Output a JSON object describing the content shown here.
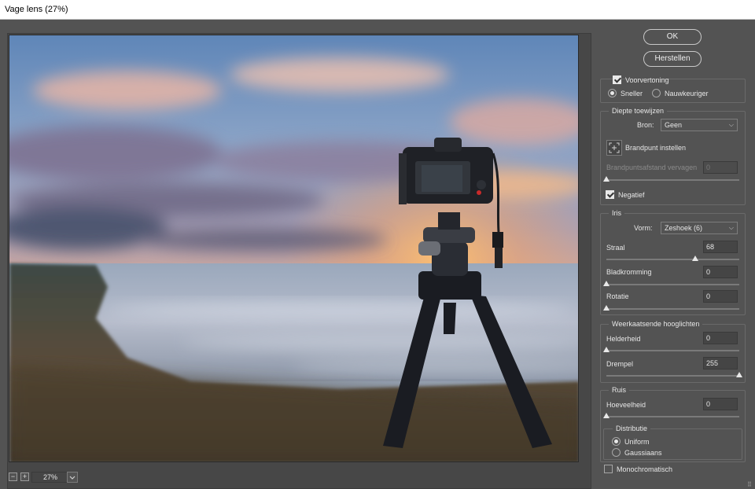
{
  "window": {
    "title": "Vage lens (27%)"
  },
  "zoom": {
    "value": "27%",
    "minus": "−",
    "plus": "+"
  },
  "buttons": {
    "ok": "OK",
    "reset": "Herstellen"
  },
  "preview_options": {
    "preview_label": "Voorvertoning",
    "preview_checked": true,
    "faster_label": "Sneller",
    "faster_selected": true,
    "accurate_label": "Nauwkeuriger"
  },
  "depth_map": {
    "title": "Diepte toewijzen",
    "source_label": "Bron:",
    "source_value": "Geen",
    "focus_label": "Brandpunt instellen",
    "blur_focal_label": "Brandpuntsafstand vervagen",
    "blur_focal_value": "0",
    "invert_label": "Negatief",
    "invert_checked": true
  },
  "iris": {
    "title": "Iris",
    "shape_label": "Vorm:",
    "shape_value": "Zeshoek (6)",
    "radius_label": "Straal",
    "radius_value": "68",
    "radius_fraction": 0.67,
    "curvature_label": "Bladkromming",
    "curvature_value": "0",
    "curvature_fraction": 0,
    "rotation_label": "Rotatie",
    "rotation_value": "0",
    "rotation_fraction": 0
  },
  "specular": {
    "title": "Weerkaatsende hooglichten",
    "brightness_label": "Helderheid",
    "brightness_value": "0",
    "brightness_fraction": 0,
    "threshold_label": "Drempel",
    "threshold_value": "255",
    "threshold_fraction": 1
  },
  "noise": {
    "title": "Ruis",
    "amount_label": "Hoeveelheid",
    "amount_value": "0",
    "amount_fraction": 0,
    "distribution_title": "Distributie",
    "uniform_label": "Uniform",
    "uniform_selected": true,
    "gaussian_label": "Gaussiaans",
    "mono_label": "Monochromatisch",
    "mono_checked": false
  },
  "icons": {
    "focus": "crosshair-icon",
    "dropdown": "chevron-down-icon",
    "grip": "resize-grip-icon"
  },
  "colors": {
    "panel": "#535353",
    "field": "#454545",
    "text": "#e6e6e6"
  }
}
